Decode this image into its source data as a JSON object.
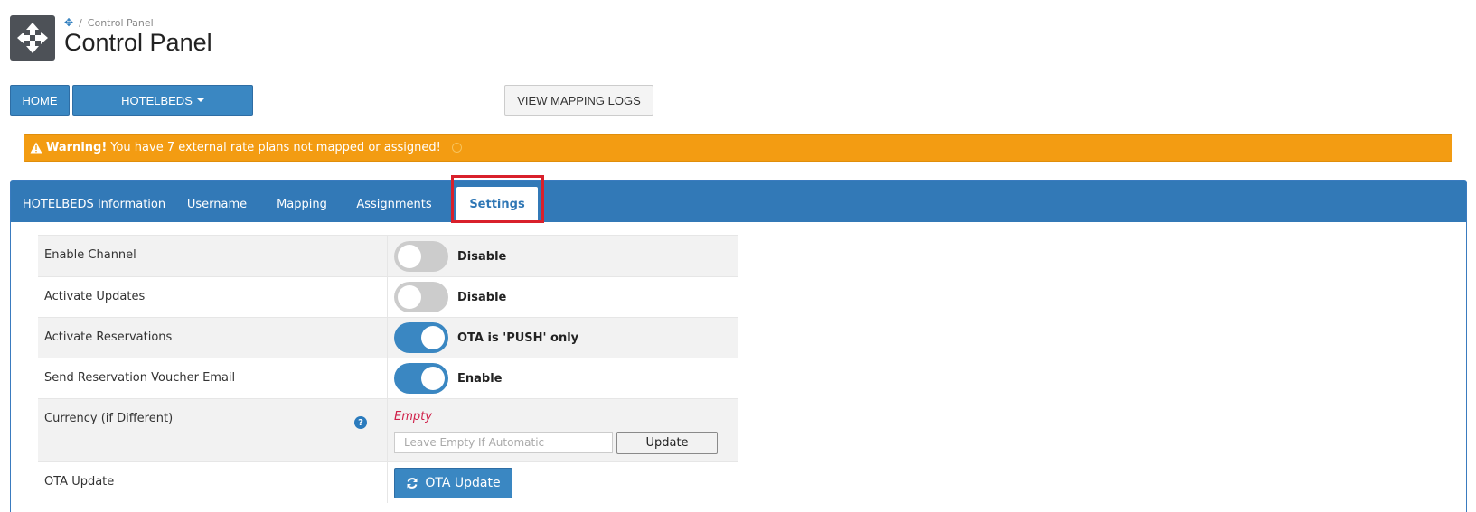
{
  "breadcrumb": {
    "current": "Control Panel"
  },
  "header": {
    "title": "Control Panel"
  },
  "toolbar": {
    "home_label": "HOME",
    "hotelbeds_label": "HOTELBEDS",
    "view_logs_label": "VIEW MAPPING LOGS"
  },
  "warning": {
    "strong": "Warning!",
    "text": "You have 7 external rate plans not mapped or assigned!"
  },
  "tabs": [
    {
      "label": "HOTELBEDS Information"
    },
    {
      "label": "Username"
    },
    {
      "label": "Mapping"
    },
    {
      "label": "Assignments"
    },
    {
      "label": "Settings",
      "active": true
    }
  ],
  "settings": {
    "enable_channel": {
      "label": "Enable Channel",
      "on": false,
      "status": "Disable"
    },
    "activate_updates": {
      "label": "Activate Updates",
      "on": false,
      "status": "Disable"
    },
    "activate_reservations": {
      "label": "Activate Reservations",
      "on": true,
      "status": "OTA is 'PUSH' only"
    },
    "send_voucher": {
      "label": "Send Reservation Voucher Email",
      "on": true,
      "status": "Enable"
    },
    "currency": {
      "label": "Currency (if Different)",
      "value": "Empty",
      "placeholder": "Leave Empty If Automatic",
      "button": "Update"
    },
    "ota_update": {
      "label": "OTA Update",
      "button": "OTA Update"
    }
  },
  "colors": {
    "primary": "#3a87c2",
    "tabbar": "#3279b7",
    "warning": "#f39c12",
    "highlight": "#d9202b"
  }
}
